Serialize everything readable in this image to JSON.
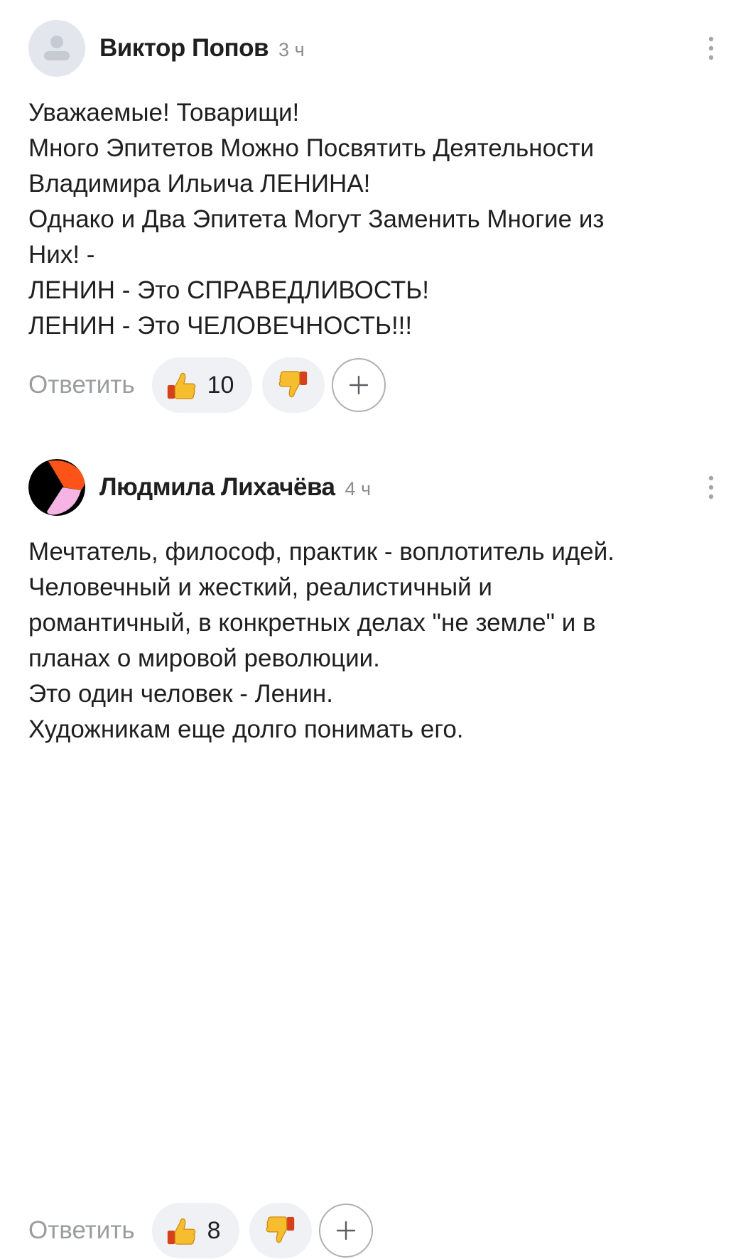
{
  "comments": [
    {
      "author": "Виктор Попов",
      "time": "3 ч",
      "avatar": "default-user-avatar",
      "lines": [
        "Уважаемые! Товарищи!",
        "Много Эпитетов Можно Посвятить Деятельности",
        "Владимира Ильича ЛЕНИНА!",
        "Однако и Два Эпитета Могут Заменить Многие из",
        "Них! -",
        "ЛЕНИН - Это СПРАВЕДЛИВОСТЬ!",
        "ЛЕНИН - Это ЧЕЛОВЕЧНОСТЬ!!!"
      ],
      "reply_label": "Ответить",
      "like_count": "10"
    },
    {
      "author": "Людмила Лихачёва",
      "time": "4 ч",
      "avatar": "abstract-color-avatar",
      "lines": [
        "Мечтатель, философ, практик - воплотитель идей.",
        "Человечный и жесткий, реалистичный и",
        "романтичный, в конкретных делах \"не земле\" и в",
        "планах о мировой революции.",
        "Это один человек - Ленин.",
        "Художникам еще долго понимать его."
      ],
      "reply_label": "Ответить",
      "like_count": "8"
    }
  ],
  "icons": {
    "like": "thumbs-up-icon",
    "dislike": "thumbs-down-icon",
    "add_reaction": "plus-icon",
    "menu": "more-vertical-icon"
  },
  "colors": {
    "author_text": "#1f1f1f",
    "meta_text": "#8b8d91",
    "reply_text": "#9a9ca0",
    "pill_bg": "#f0f1f4",
    "placeholder_avatar_bg": "#e3e6ec",
    "placeholder_avatar_fg": "#c6cbd3",
    "avatar_orange": "#fc5418",
    "avatar_pink": "#f5b4e3",
    "avatar_black": "#000000"
  }
}
